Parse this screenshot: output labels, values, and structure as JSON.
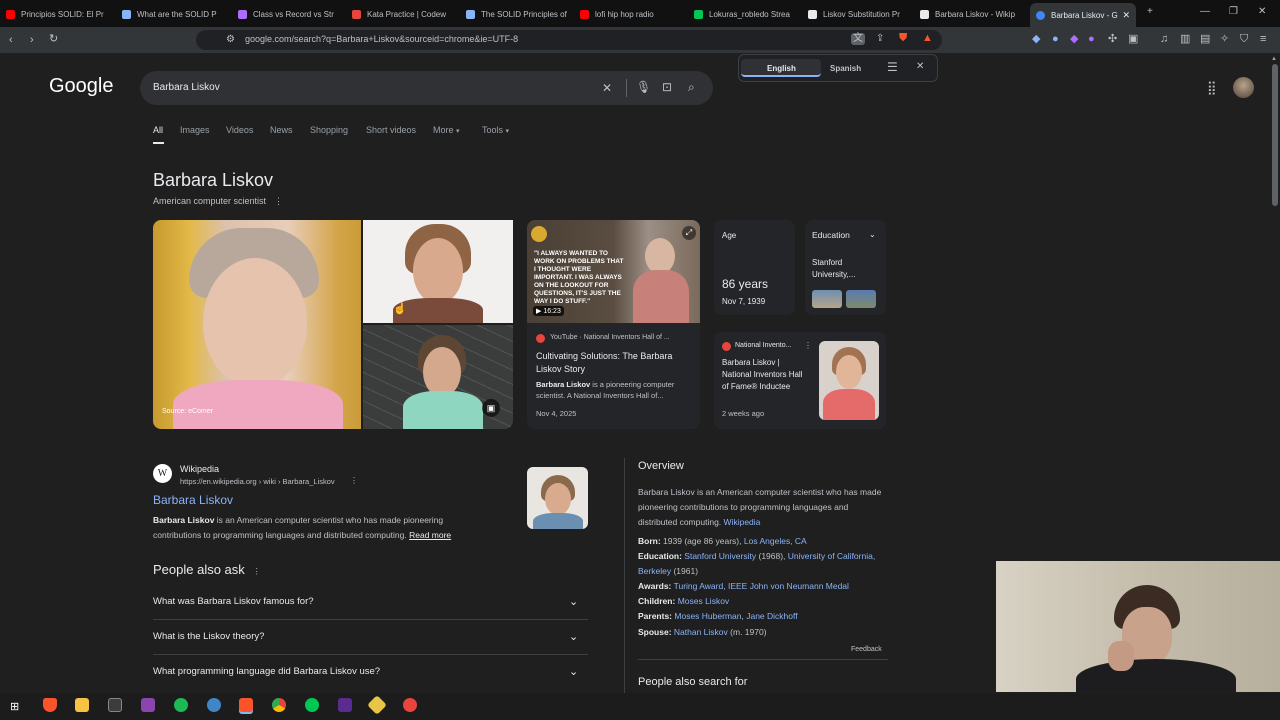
{
  "browser": {
    "tabs": [
      {
        "label": "Principios SOLID: El Pr",
        "color": "#ff0000"
      },
      {
        "label": "What are the SOLID P",
        "color": "#8ab4f8"
      },
      {
        "label": "Class vs Record vs Str",
        "color": "#b06cff"
      },
      {
        "label": "Kata Practice | Codew",
        "color": "#e8453c"
      },
      {
        "label": "The SOLID Principles of",
        "color": "#8ab4f8"
      },
      {
        "label": "lofi hip hop radio",
        "color": "#ff0000"
      },
      {
        "label": "Lokuras_robledo Strea",
        "color": "#00c853"
      },
      {
        "label": "Liskov Substitution Pr",
        "color": "#e8eaed"
      },
      {
        "label": "Barbara Liskov - Wikip",
        "color": "#e8eaed"
      },
      {
        "label": "Barbara Liskov - G",
        "color": "#4285f4"
      }
    ],
    "url": "google.com/search?q=Barbara+Liskov&sourceid=chrome&ie=UTF-8"
  },
  "translate": {
    "english": "English",
    "spanish": "Spanish"
  },
  "search": {
    "logo": "Google",
    "query": "Barbara Liskov",
    "nav": [
      "All",
      "Images",
      "Videos",
      "News",
      "Shopping",
      "Short videos",
      "More",
      "Tools"
    ]
  },
  "entity": {
    "name": "Barbara Liskov",
    "description": "American computer scientist",
    "image_source": "Source: eComer",
    "video": {
      "overlay": "\"I ALWAYS WANTED TO WORK ON PROBLEMS THAT I THOUGHT WERE IMPORTANT. I WAS ALWAYS ON THE LOOKOUT FOR QUESTIONS, IT'S JUST THE WAY I DO STUFF.\"",
      "duration": "16:23",
      "source": "YouTube · National Inventors Hall of ...",
      "title": "Cultivating Solutions: The Barbara Liskov Story",
      "snippet_bold": "Barbara Liskov",
      "snippet": " is a pioneering computer scientist. A National Inventors Hall of...",
      "date": "Nov 4, 2025"
    },
    "age": {
      "label": "Age",
      "value": "86 years",
      "birth": "Nov 7, 1939"
    },
    "education": {
      "label": "Education",
      "value": "Stanford University,..."
    },
    "news": {
      "source": "National Invento...",
      "title": "Barbara Liskov | National Inventors Hall of Fame® Inductee",
      "time": "2 weeks ago"
    }
  },
  "wiki": {
    "site": "Wikipedia",
    "url": "https://en.wikipedia.org › wiki › Barbara_Liskov",
    "title": "Barbara Liskov",
    "snippet_bold": "Barbara Liskov",
    "snippet": " is an American computer scientist who has made pioneering contributions to programming languages and distributed computing.",
    "read_more": "Read more"
  },
  "paa": {
    "heading": "People also ask",
    "questions": [
      "What was Barbara Liskov famous for?",
      "What is the Liskov theory?",
      "What programming language did Barbara Liskov use?"
    ]
  },
  "overview": {
    "heading": "Overview",
    "text": "Barbara Liskov is an American computer scientist who has made pioneering contributions to programming languages and distributed computing.",
    "link": "Wikipedia",
    "born_label": "Born:",
    "born_text": "1939 (age 86 years),",
    "born_link": "Los Angeles, CA",
    "edu_label": "Education:",
    "edu_link1": "Stanford University",
    "edu_text1": "(1968),",
    "edu_link2": "University of California, Berkeley",
    "edu_text2": "(1961)",
    "awards_label": "Awards:",
    "awards_link1": "Turing Award",
    "awards_link2": "IEEE John von Neumann Medal",
    "children_label": "Children:",
    "children_link": "Moses Liskov",
    "parents_label": "Parents:",
    "parents_link1": "Moses Huberman",
    "parents_link2": "Jane Dickhoff",
    "spouse_label": "Spouse:",
    "spouse_link": "Nathan Liskov",
    "spouse_text": "(m. 1970)",
    "feedback": "Feedback",
    "also_search": "People also search for"
  }
}
